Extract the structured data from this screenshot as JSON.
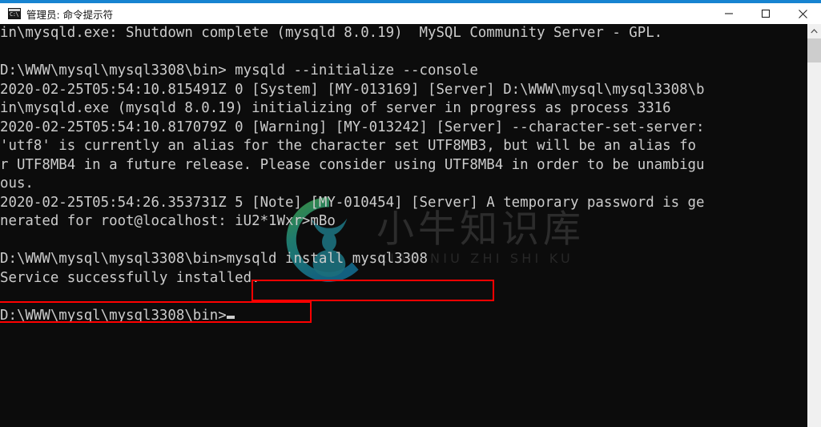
{
  "window": {
    "title": "管理员: 命令提示符",
    "icon": "cmd-console-icon",
    "icon_text": "C:\\",
    "accent_color": "#1784d1",
    "controls": {
      "minimize": "minimize-icon",
      "maximize": "maximize-icon",
      "close": "close-icon"
    }
  },
  "console": {
    "background_color": "#0c0c0c",
    "foreground_color": "#cccccc",
    "lines": [
      "in\\mysqld.exe: Shutdown complete (mysqld 8.0.19)  MySQL Community Server - GPL.",
      "",
      "D:\\WWW\\mysql\\mysql3308\\bin> mysqld --initialize --console",
      "2020-02-25T05:54:10.815491Z 0 [System] [MY-013169] [Server] D:\\WWW\\mysql\\mysql3308\\b",
      "in\\mysqld.exe (mysqld 8.0.19) initializing of server in progress as process 3316",
      "2020-02-25T05:54:10.817079Z 0 [Warning] [MY-013242] [Server] --character-set-server:",
      "'utf8' is currently an alias for the character set UTF8MB3, but will be an alias fo",
      "r UTF8MB4 in a future release. Please consider using UTF8MB4 in order to be unambigu",
      "ous.",
      "2020-02-25T05:54:26.353731Z 5 [Note] [MY-010454] [Server] A temporary password is ge",
      "nerated for root@localhost: iU2*1Wxr>mBo",
      "",
      "D:\\WWW\\mysql\\mysql3308\\bin>mysqld install mysql3308",
      "Service successfully installed.",
      "",
      "D:\\WWW\\mysql\\mysql3308\\bin>"
    ],
    "prompt": "D:\\WWW\\mysql\\mysql3308\\bin>",
    "command_highlighted": "mysqld install mysql3308",
    "result_highlighted": "Service successfully installed.",
    "temporary_password": "iU2*1Wxr>mBo",
    "cursor": "block-cursor"
  },
  "annotations": {
    "color": "#ff0000",
    "boxes": [
      {
        "name": "command",
        "label": "mysqld install mysql3308"
      },
      {
        "name": "result",
        "label": "Service successfully installed."
      }
    ]
  },
  "watermark": {
    "chinese": "小牛知识库",
    "pinyin": "XIAO NIU ZHI SHI KU",
    "logo": "bull-circle-logo"
  },
  "scrollbar": {
    "up_arrow": "chevron-up-icon",
    "thumb": "scrollbar-thumb"
  }
}
